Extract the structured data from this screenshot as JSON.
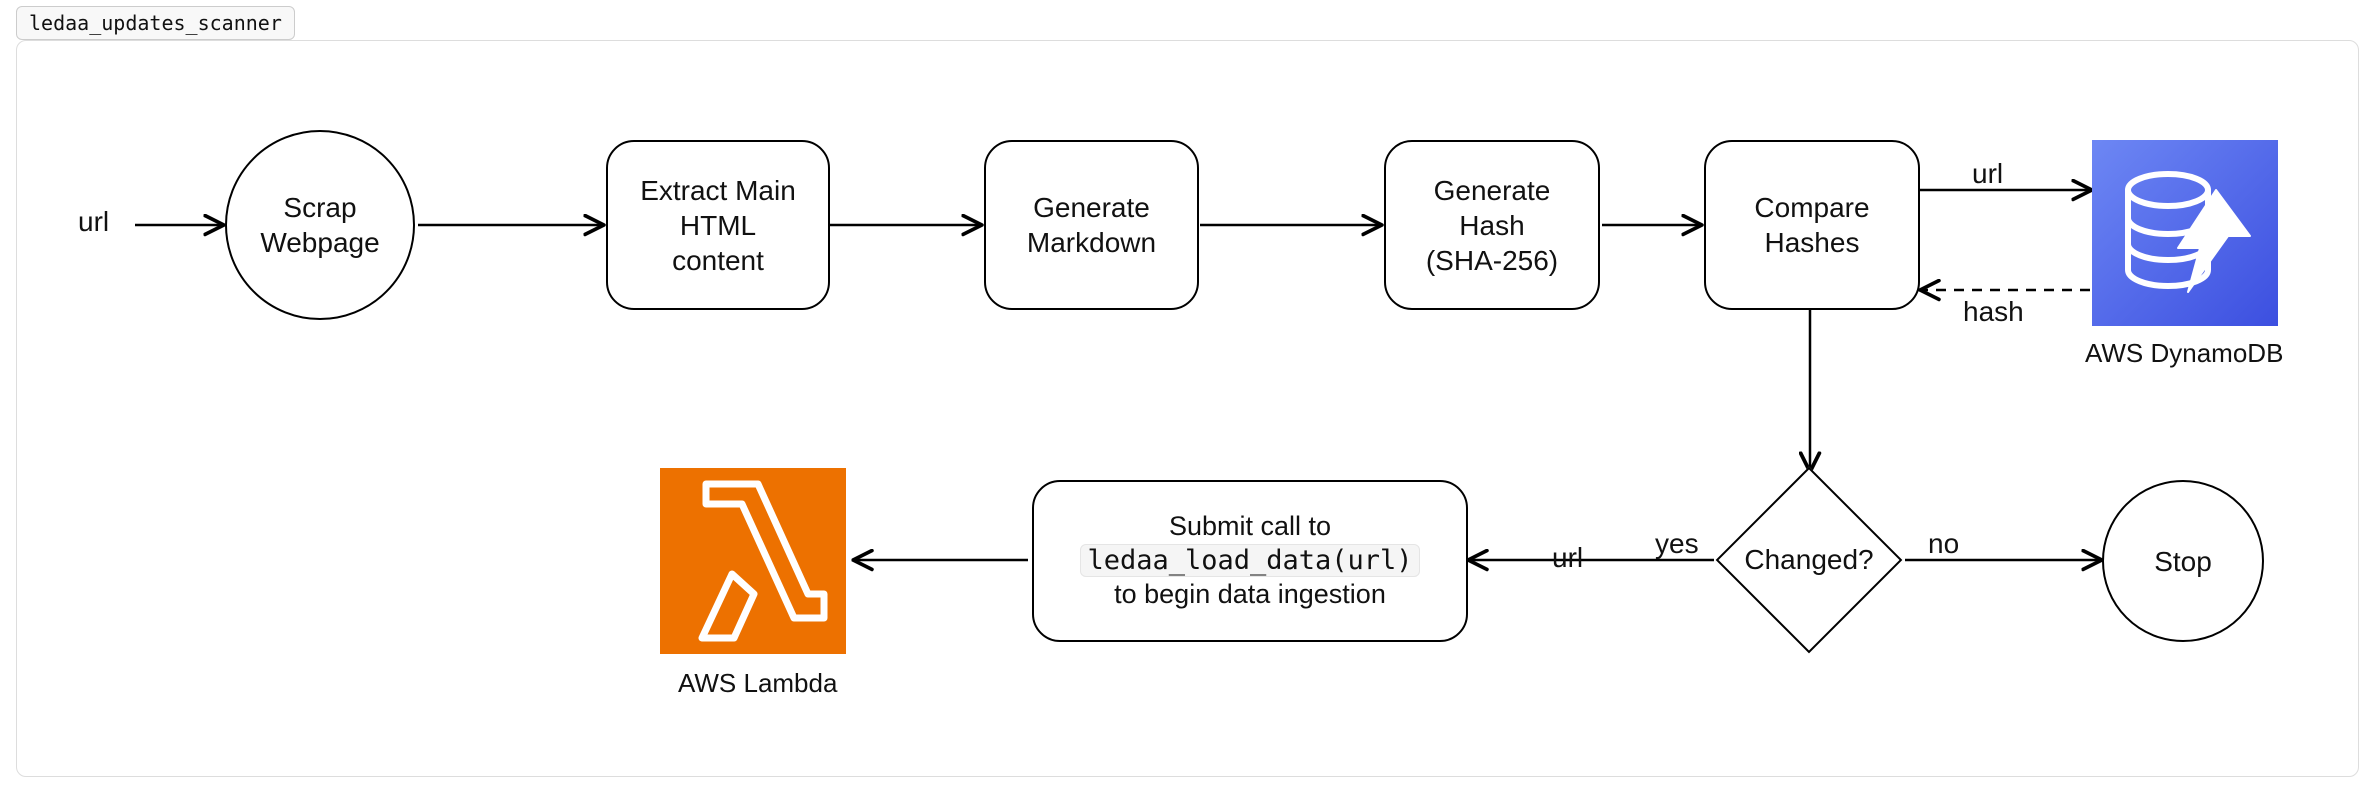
{
  "frame_tag": "ledaa_updates_scanner",
  "input_label": "url",
  "nodes": {
    "scrap": "Scrap\nWebpage",
    "extract": "Extract Main\nHTML\ncontent",
    "markdown": "Generate\nMarkdown",
    "hash": "Generate\nHash\n(SHA-256)",
    "compare": "Compare\nHashes",
    "changed": "Changed?",
    "stop": "Stop",
    "submit_pre": "Submit call to",
    "submit_code": "ledaa_load_data(url)",
    "submit_post": "to begin data ingestion"
  },
  "edges": {
    "to_dynamo": "url",
    "from_dynamo": "hash",
    "yes": "yes",
    "no": "no",
    "to_submit": "url"
  },
  "services": {
    "dynamo": "AWS DynamoDB",
    "lambda": "AWS Lambda"
  },
  "colors": {
    "lambda": "#ed7100",
    "dynamo1": "#6d87f4",
    "dynamo2": "#3c4fe0"
  }
}
